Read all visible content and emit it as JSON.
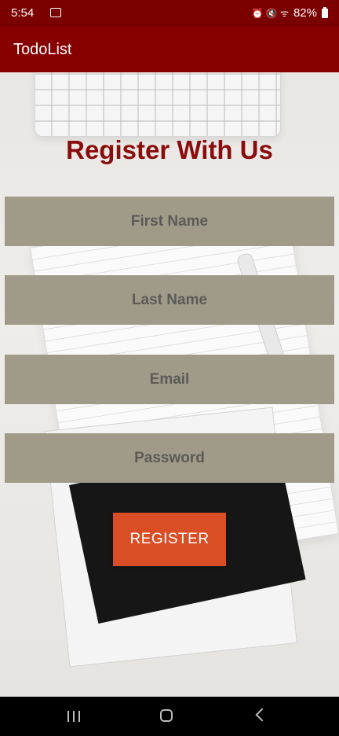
{
  "status_bar": {
    "time": "5:54",
    "glyphs": "⏰ 🔇 ᯤ",
    "battery": "82%"
  },
  "app_bar": {
    "title": "TodoList"
  },
  "register": {
    "heading": "Register With Us",
    "fields": {
      "first_name_placeholder": "First Name",
      "last_name_placeholder": "Last Name",
      "email_placeholder": "Email",
      "password_placeholder": "Password"
    },
    "button_label": "REGISTER"
  },
  "colors": {
    "app_bar": "#870000",
    "heading": "#8a0c0c",
    "field_background": "#a09b89",
    "button": "#d94e25"
  }
}
